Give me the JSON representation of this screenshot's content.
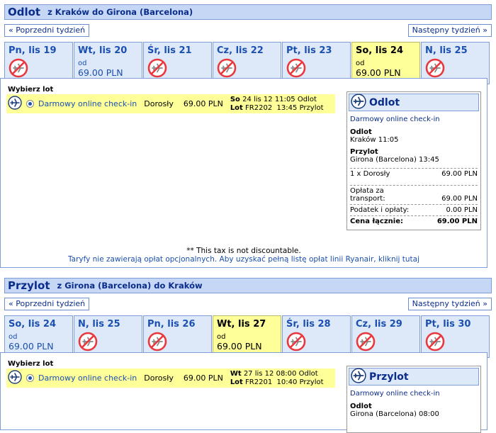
{
  "outbound": {
    "title": "Odlot",
    "route": "z Kraków do Girona (Barcelona)",
    "prev_week": "« Poprzedni tydzień",
    "next_week": "Następny tydzień »",
    "days": [
      {
        "name": "Pn, lis 19",
        "available": false
      },
      {
        "name": "Wt, lis 20",
        "available": true,
        "od": "od",
        "price": "69.00 PLN"
      },
      {
        "name": "Śr, lis 21",
        "available": false
      },
      {
        "name": "Cz, lis 22",
        "available": false
      },
      {
        "name": "Pt, lis 23",
        "available": false
      },
      {
        "name": "So, lis 24",
        "available": true,
        "od": "od",
        "price": "69.00 PLN",
        "selected": true
      },
      {
        "name": "N, lis 25",
        "available": false
      }
    ],
    "choose_label": "Wybierz lot",
    "flight": {
      "fare": "Darmowy online check-in",
      "pax": "Dorosły",
      "price": "69.00 PLN",
      "day_label": "So",
      "date": "24 lis 12",
      "dep_time": "11:05",
      "dep_label": "Odlot",
      "flight_label": "Lot",
      "flight_no": "FR2202",
      "arr_time": "13:45",
      "arr_label": "Przylot"
    },
    "summary": {
      "title": "Odlot",
      "fare": "Darmowy online check-in",
      "dep_label": "Odlot",
      "dep_value": "Kraków 11:05",
      "arr_label": "Przylot",
      "arr_value": "Girona (Barcelona) 13:45",
      "pax_line": "1 x Dorosły",
      "pax_price": "69.00 PLN",
      "transport_label": "Opłata za transport:",
      "transport_value": "69.00 PLN",
      "tax_label": "Podatek i opłaty:",
      "tax_value": "0.00 PLN",
      "total_label": "Cena łącznie:",
      "total_value": "69.00 PLN"
    },
    "tax_note": "** This tax is not discountable.",
    "tariff_note": "Taryfy nie zawierają opłat opcjonalnych. Aby uzyskać pełną listę opłat linii Ryanair, kliknij tutaj"
  },
  "inbound": {
    "title": "Przylot",
    "route": "z Girona (Barcelona) do Kraków",
    "prev_week": "« Poprzedni tydzień",
    "next_week": "Następny tydzień »",
    "days": [
      {
        "name": "So, lis 24",
        "available": true,
        "od": "od",
        "price": "69.00 PLN"
      },
      {
        "name": "N, lis 25",
        "available": false
      },
      {
        "name": "Pn, lis 26",
        "available": false
      },
      {
        "name": "Wt, lis 27",
        "available": true,
        "od": "od",
        "price": "69.00 PLN",
        "selected": true
      },
      {
        "name": "Śr, lis 28",
        "available": false
      },
      {
        "name": "Cz, lis 29",
        "available": false
      },
      {
        "name": "Pt, lis 30",
        "available": false
      }
    ],
    "choose_label": "Wybierz lot",
    "flight": {
      "fare": "Darmowy online check-in",
      "pax": "Dorosły",
      "price": "69.00 PLN",
      "day_label": "Wt",
      "date": "27 lis 12",
      "dep_time": "08:00",
      "dep_label": "Odlot",
      "flight_label": "Lot",
      "flight_no": "FR2201",
      "arr_time": "10:40",
      "arr_label": "Przylot"
    },
    "summary": {
      "title": "Przylot",
      "fare": "Darmowy online check-in",
      "dep_label": "Odlot",
      "dep_value": "Girona (Barcelona) 08:00"
    }
  },
  "icons": {
    "no_flight": "no-flight-icon",
    "plane": "plane-icon"
  },
  "colors": {
    "header_bg": "#c6d7f5",
    "day_bg": "#dde9f9",
    "selected_bg": "#ffff99",
    "link": "#1b4fb0",
    "no_flight": "#e8383d"
  }
}
